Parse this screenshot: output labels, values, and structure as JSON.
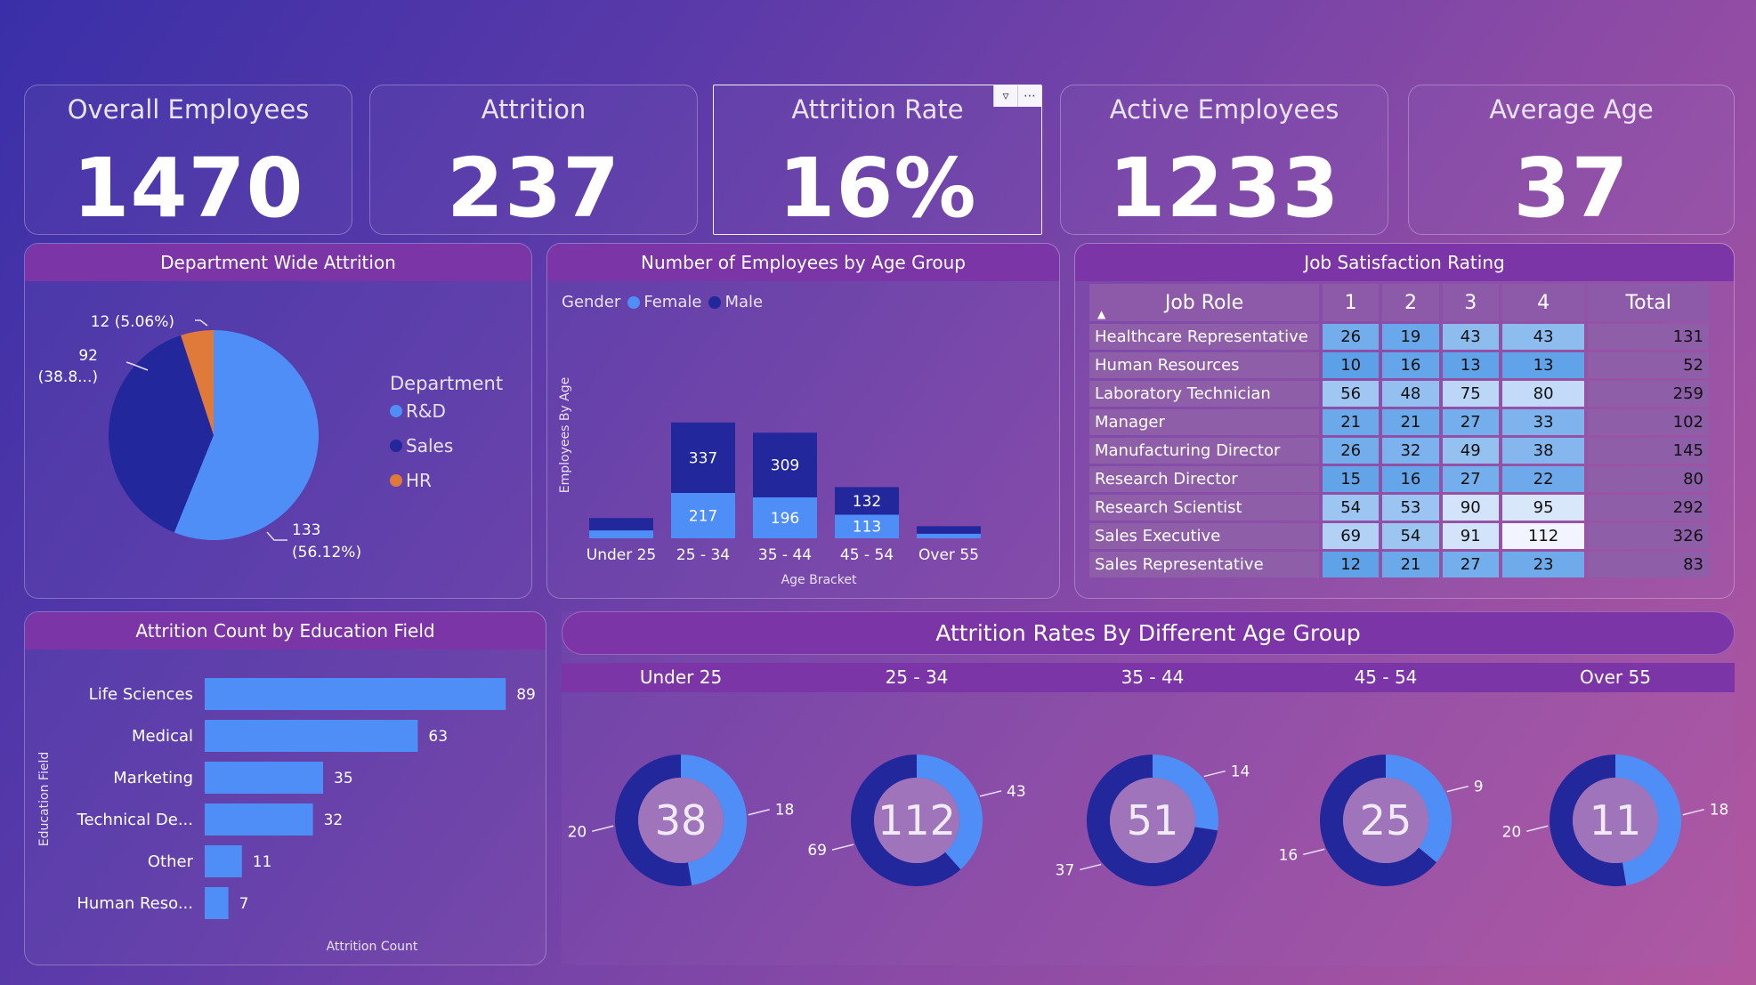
{
  "kpis": [
    {
      "label": "Overall Employees",
      "value": "1470"
    },
    {
      "label": "Attrition",
      "value": "237"
    },
    {
      "label": "Attrition Rate",
      "value": "16%"
    },
    {
      "label": "Active Employees",
      "value": "1233"
    },
    {
      "label": "Average Age",
      "value": "37"
    }
  ],
  "dept": {
    "title": "Department Wide Attrition",
    "legend_title": "Department",
    "items": [
      {
        "name": "R&D",
        "value": 133,
        "label": "133",
        "pct": "(56.12%)",
        "color": "#4f8ef7"
      },
      {
        "name": "Sales",
        "value": 92,
        "label": "92",
        "pct": "(38.8...)",
        "color": "#22279c"
      },
      {
        "name": "HR",
        "value": 12,
        "label": "12 (5.06%)",
        "pct": "",
        "color": "#e07a3a"
      }
    ]
  },
  "age": {
    "title": "Number of Employees by Age Group",
    "legend_title": "Gender",
    "female_label": "Female",
    "male_label": "Male",
    "female_color": "#4f8ef7",
    "male_color": "#22279c",
    "ylabel": "Employees By Age",
    "xlabel": "Age Bracket"
  },
  "job": {
    "title": "Job Satisfaction Rating",
    "headers": [
      "Job Role",
      "1",
      "2",
      "3",
      "4",
      "Total"
    ],
    "rows": [
      {
        "role": "Healthcare Representative",
        "v": [
          26,
          19,
          43,
          43
        ],
        "total": 131
      },
      {
        "role": "Human Resources",
        "v": [
          10,
          16,
          13,
          13
        ],
        "total": 52
      },
      {
        "role": "Laboratory Technician",
        "v": [
          56,
          48,
          75,
          80
        ],
        "total": 259
      },
      {
        "role": "Manager",
        "v": [
          21,
          21,
          27,
          33
        ],
        "total": 102
      },
      {
        "role": "Manufacturing Director",
        "v": [
          26,
          32,
          49,
          38
        ],
        "total": 145
      },
      {
        "role": "Research Director",
        "v": [
          15,
          16,
          27,
          22
        ],
        "total": 80
      },
      {
        "role": "Research Scientist",
        "v": [
          54,
          53,
          90,
          95
        ],
        "total": 292
      },
      {
        "role": "Sales Executive",
        "v": [
          69,
          54,
          91,
          112
        ],
        "total": 326
      },
      {
        "role": "Sales Representative",
        "v": [
          12,
          21,
          27,
          23
        ],
        "total": 83
      }
    ]
  },
  "edu": {
    "title": "Attrition Count by Education Field",
    "ylabel": "Education Field",
    "xlabel": "Attrition Count"
  },
  "donuts": {
    "title": "Attrition Rates By Different Age Group",
    "groups": [
      {
        "label": "Under 25",
        "center": "38",
        "a": 20,
        "b": 18
      },
      {
        "label": "25 - 34",
        "center": "112",
        "a": 69,
        "b": 43
      },
      {
        "label": "35 - 44",
        "center": "51",
        "a": 37,
        "b": 14
      },
      {
        "label": "45 - 54",
        "center": "25",
        "a": 16,
        "b": 9
      },
      {
        "label": "Over 55",
        "center": "11",
        "a": 20,
        "b": 18
      }
    ]
  },
  "chart_data": [
    {
      "type": "pie",
      "title": "Department Wide Attrition",
      "categories": [
        "R&D",
        "Sales",
        "HR"
      ],
      "values": [
        133,
        92,
        12
      ]
    },
    {
      "type": "bar",
      "title": "Number of Employees by Age Group",
      "xlabel": "Age Bracket",
      "ylabel": "Employees By Age",
      "categories": [
        "Under 25",
        "25 - 34",
        "35 - 44",
        "45 - 54",
        "Over 55"
      ],
      "series": [
        {
          "name": "Female",
          "values": [
            38,
            217,
            196,
            113,
            22
          ]
        },
        {
          "name": "Male",
          "values": [
            59,
            337,
            309,
            132,
            36
          ]
        }
      ],
      "labels_shown": {
        "Female": [
          null,
          "217",
          "196",
          "113",
          null
        ],
        "Male": [
          null,
          "337",
          "309",
          "132",
          null
        ]
      }
    },
    {
      "type": "bar",
      "title": "Attrition Count by Education Field",
      "xlabel": "Attrition Count",
      "ylabel": "Education Field",
      "categories": [
        "Life Sciences",
        "Medical",
        "Marketing",
        "Technical De...",
        "Other",
        "Human Reso..."
      ],
      "values": [
        89,
        63,
        35,
        32,
        11,
        7
      ]
    },
    {
      "type": "pie",
      "title": "Attrition Rates By Different Age Group",
      "categories": [
        "Under 25",
        "25 - 34",
        "35 - 44",
        "45 - 54",
        "Over 55"
      ],
      "series": [
        {
          "values": [
            20,
            69,
            37,
            16,
            20
          ]
        },
        {
          "values": [
            18,
            43,
            14,
            9,
            18
          ]
        }
      ],
      "totals": [
        38,
        112,
        51,
        25,
        11
      ]
    }
  ]
}
